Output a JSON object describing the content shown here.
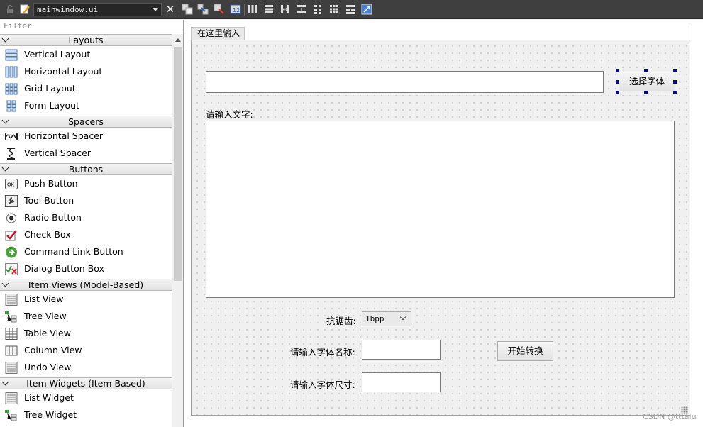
{
  "toolbar": {
    "file_name": "mainwindow.ui",
    "icons": [
      "lock-icon",
      "edit-icon",
      "close-icon",
      "widget-editor-icon",
      "signal-slot-editor-icon",
      "buddy-editor-icon",
      "tab-order-editor-icon",
      "layout-horizontal-icon",
      "layout-vertical-icon",
      "layout-horizontal-splitter-icon",
      "layout-vertical-splitter-icon",
      "layout-form-icon",
      "layout-grid-icon",
      "break-layout-icon",
      "adjust-size-icon"
    ]
  },
  "sidebar": {
    "filter_placeholder": "Filter",
    "categories": [
      {
        "title": "Layouts",
        "items": [
          {
            "label": "Vertical Layout",
            "icon": "vertical-layout-icon"
          },
          {
            "label": "Horizontal Layout",
            "icon": "horizontal-layout-icon"
          },
          {
            "label": "Grid Layout",
            "icon": "grid-layout-icon"
          },
          {
            "label": "Form Layout",
            "icon": "form-layout-icon"
          }
        ]
      },
      {
        "title": "Spacers",
        "items": [
          {
            "label": "Horizontal Spacer",
            "icon": "horizontal-spacer-icon"
          },
          {
            "label": "Vertical Spacer",
            "icon": "vertical-spacer-icon"
          }
        ]
      },
      {
        "title": "Buttons",
        "items": [
          {
            "label": "Push Button",
            "icon": "push-button-icon"
          },
          {
            "label": "Tool Button",
            "icon": "tool-button-icon"
          },
          {
            "label": "Radio Button",
            "icon": "radio-button-icon"
          },
          {
            "label": "Check Box",
            "icon": "check-box-icon"
          },
          {
            "label": "Command Link Button",
            "icon": "command-link-icon"
          },
          {
            "label": "Dialog Button Box",
            "icon": "dialog-button-box-icon"
          }
        ]
      },
      {
        "title": "Item Views (Model-Based)",
        "items": [
          {
            "label": "List View",
            "icon": "list-view-icon"
          },
          {
            "label": "Tree View",
            "icon": "tree-view-icon"
          },
          {
            "label": "Table View",
            "icon": "table-view-icon"
          },
          {
            "label": "Column View",
            "icon": "column-view-icon"
          },
          {
            "label": "Undo View",
            "icon": "undo-view-icon"
          }
        ]
      },
      {
        "title": "Item Widgets (Item-Based)",
        "items": [
          {
            "label": "List Widget",
            "icon": "list-widget-icon"
          },
          {
            "label": "Tree Widget",
            "icon": "tree-widget-icon"
          }
        ]
      }
    ]
  },
  "form": {
    "tab_title": "在这里输入",
    "select_font_button": "选择字体",
    "text_input_label": "请输入文字:",
    "antialias_label": "抗锯齿:",
    "antialias_value": "1bpp",
    "font_name_label": "请输入字体名称:",
    "font_size_label": "请输入字体尺寸:",
    "start_convert_button": "开始转换"
  },
  "watermark": "CSDN @tttalu"
}
